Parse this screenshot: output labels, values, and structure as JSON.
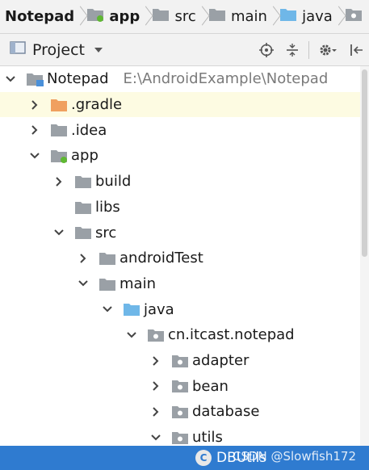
{
  "breadcrumb": {
    "items": [
      {
        "label": "Notepad",
        "icon": "project-icon",
        "bold": true
      },
      {
        "label": "app",
        "icon": "module-folder-icon",
        "bold": true
      },
      {
        "label": "src",
        "icon": "folder-icon",
        "bold": false
      },
      {
        "label": "main",
        "icon": "folder-icon",
        "bold": false
      },
      {
        "label": "java",
        "icon": "source-folder-icon",
        "bold": false
      },
      {
        "label": "",
        "icon": "package-folder-icon",
        "bold": false
      }
    ]
  },
  "toolbar": {
    "title": "Project",
    "buttons": [
      "locate-icon",
      "collapse-all-icon",
      "gear-icon",
      "hide-icon"
    ]
  },
  "tree": {
    "rows": [
      {
        "label": "Notepad",
        "path": "E:\\AndroidExample\\Notepad",
        "level": 0,
        "arrow": "down",
        "icon": "project"
      },
      {
        "label": ".gradle",
        "level": 1,
        "arrow": "right",
        "icon": "folder-orange",
        "highlight": true
      },
      {
        "label": ".idea",
        "level": 1,
        "arrow": "right",
        "icon": "folder"
      },
      {
        "label": "app",
        "level": 1,
        "arrow": "down",
        "icon": "module"
      },
      {
        "label": "build",
        "level": 2,
        "arrow": "right",
        "icon": "folder"
      },
      {
        "label": "libs",
        "level": 2,
        "arrow": "none",
        "icon": "folder"
      },
      {
        "label": "src",
        "level": 2,
        "arrow": "down",
        "icon": "folder"
      },
      {
        "label": "androidTest",
        "level": 3,
        "arrow": "right",
        "icon": "folder"
      },
      {
        "label": "main",
        "level": 3,
        "arrow": "down",
        "icon": "folder"
      },
      {
        "label": "java",
        "level": 4,
        "arrow": "down",
        "icon": "source"
      },
      {
        "label": "cn.itcast.notepad",
        "level": 5,
        "arrow": "down",
        "icon": "package"
      },
      {
        "label": "adapter",
        "level": 6,
        "arrow": "right",
        "icon": "package"
      },
      {
        "label": "bean",
        "level": 6,
        "arrow": "right",
        "icon": "package"
      },
      {
        "label": "database",
        "level": 6,
        "arrow": "right",
        "icon": "package"
      },
      {
        "label": "utils",
        "level": 6,
        "arrow": "down",
        "icon": "package"
      }
    ]
  },
  "status": {
    "label": "DBUtils",
    "icon_letter": "C",
    "watermark": "CSDN @Slowfish172"
  },
  "colors": {
    "folder": "#9aa0a6",
    "folder_orange": "#f0a060",
    "source_folder": "#6fb7e8",
    "module_dot": "#5fb832",
    "status_bar": "#2f7bd0",
    "highlight_row": "#fdfbe2"
  }
}
